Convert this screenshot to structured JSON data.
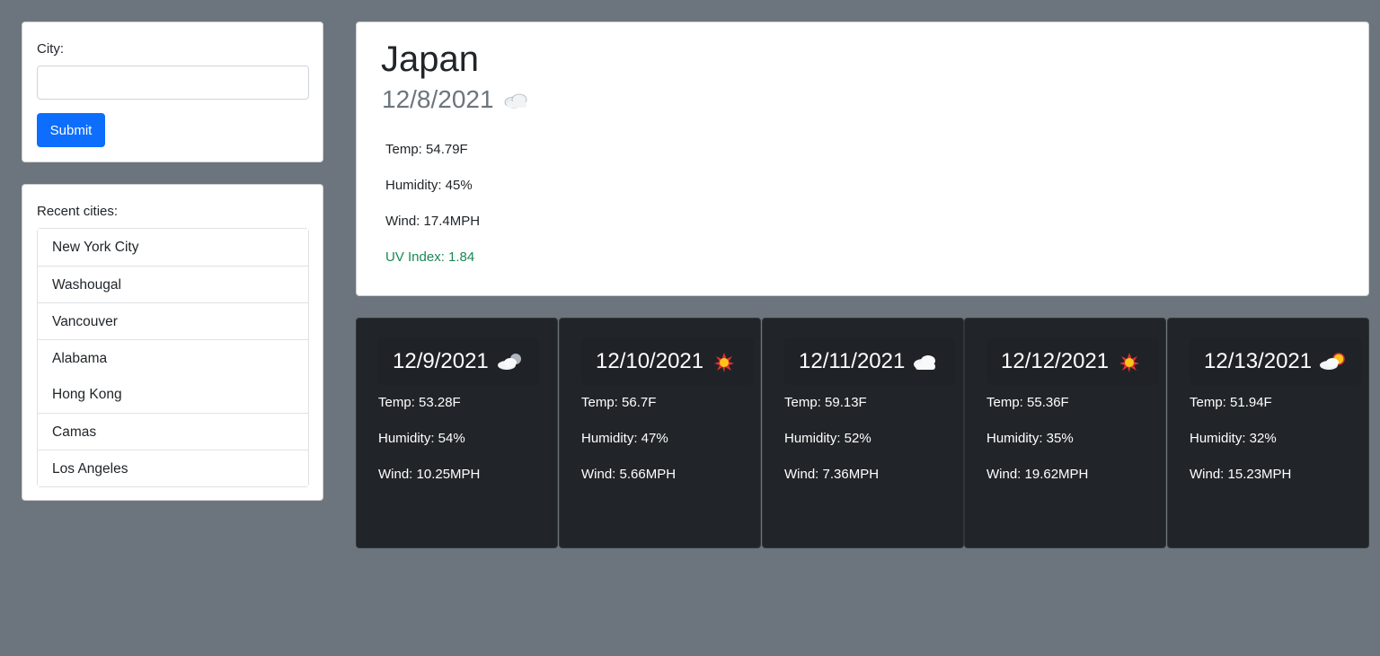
{
  "search": {
    "label": "City:",
    "input_value": "",
    "placeholder": "",
    "submit_label": "Submit"
  },
  "recent": {
    "label": "Recent cities:",
    "cities": [
      "New York City",
      "Washougal",
      "Vancouver",
      "Alabama",
      "Hong Kong",
      "Camas",
      "Los Angeles"
    ]
  },
  "current": {
    "city": "Japan",
    "date": "12/8/2021",
    "icon": "cloud-icon",
    "temp": "Temp: 54.79F",
    "humidity": "Humidity: 45%",
    "wind": "Wind: 17.4MPH",
    "uv": "UV Index: 1.84",
    "uv_color": "#198754"
  },
  "forecast": [
    {
      "date": "12/9/2021",
      "icon": "cloud-moon-icon",
      "temp": "Temp: 53.28F",
      "humidity": "Humidity: 54%",
      "wind": "Wind: 10.25MPH"
    },
    {
      "date": "12/10/2021",
      "icon": "sun-icon",
      "temp": "Temp: 56.7F",
      "humidity": "Humidity: 47%",
      "wind": "Wind: 5.66MPH"
    },
    {
      "date": "12/11/2021",
      "icon": "cloud-icon",
      "temp": "Temp: 59.13F",
      "humidity": "Humidity: 52%",
      "wind": "Wind: 7.36MPH"
    },
    {
      "date": "12/12/2021",
      "icon": "sun-icon",
      "temp": "Temp: 55.36F",
      "humidity": "Humidity: 35%",
      "wind": "Wind: 19.62MPH"
    },
    {
      "date": "12/13/2021",
      "icon": "cloud-sun-icon",
      "temp": "Temp: 51.94F",
      "humidity": "Humidity: 32%",
      "wind": "Wind: 15.23MPH"
    }
  ],
  "colors": {
    "page_bg": "#6c757d",
    "primary": "#0d6efd",
    "forecast_bg": "#212529"
  }
}
